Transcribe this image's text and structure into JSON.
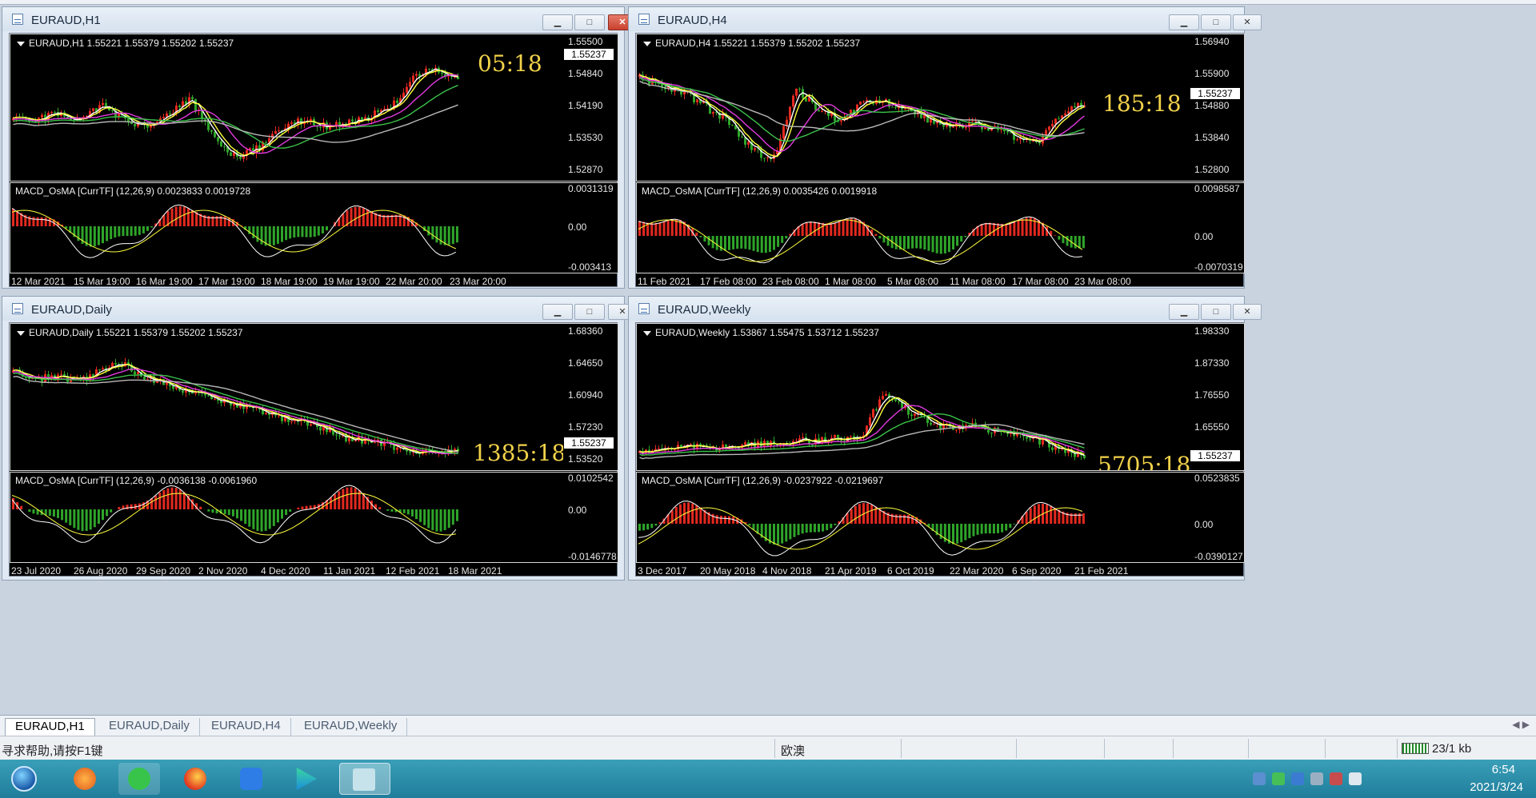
{
  "windows": [
    {
      "id": "h1",
      "title": "EURAUD,H1",
      "info": "EURAUD,H1  1.55221 1.55379 1.55202 1.55237",
      "timer": "05:18",
      "price_ticks": [
        "1.55500",
        "1.54840",
        "1.54190",
        "1.53530",
        "1.52870"
      ],
      "current_price": "1.55237",
      "osma_label": "MACD_OsMA [CurrTF] (12,26,9) 0.0023833 0.0019728",
      "osma_ticks": [
        "0.0031319",
        "0.00",
        "-0.003413"
      ],
      "time_labels": [
        "12 Mar 2021",
        "15 Mar 19:00",
        "16 Mar 19:00",
        "17 Mar 19:00",
        "18 Mar 19:00",
        "19 Mar 19:00",
        "22 Mar 20:00",
        "23 Mar 20:00"
      ],
      "active": true
    },
    {
      "id": "h4",
      "title": "EURAUD,H4",
      "info": "EURAUD,H4  1.55221 1.55379 1.55202 1.55237",
      "timer": "185:18",
      "price_ticks": [
        "1.56940",
        "1.55900",
        "1.54880",
        "1.53840",
        "1.52800"
      ],
      "current_price": "1.55237",
      "osma_label": "MACD_OsMA [CurrTF] (12,26,9) 0.0035426 0.0019918",
      "osma_ticks": [
        "0.0098587",
        "0.00",
        "-0.0070319"
      ],
      "time_labels": [
        "11 Feb 2021",
        "17 Feb 08:00",
        "23 Feb 08:00",
        "1 Mar 08:00",
        "5 Mar 08:00",
        "11 Mar 08:00",
        "17 Mar 08:00",
        "23 Mar 08:00"
      ],
      "active": false
    },
    {
      "id": "daily",
      "title": "EURAUD,Daily",
      "info": "EURAUD,Daily  1.55221 1.55379 1.55202 1.55237",
      "timer": "1385:18",
      "price_ticks": [
        "1.68360",
        "1.64650",
        "1.60940",
        "1.57230",
        "1.53520"
      ],
      "current_price": "1.55237",
      "osma_label": "MACD_OsMA [CurrTF] (12,26,9) -0.0036138 -0.0061960",
      "osma_ticks": [
        "0.0102542",
        "0.00",
        "-0.0146778"
      ],
      "time_labels": [
        "23 Jul 2020",
        "26 Aug 2020",
        "29 Sep 2020",
        "2 Nov 2020",
        "4 Dec 2020",
        "11 Jan 2021",
        "12 Feb 2021",
        "18 Mar 2021"
      ],
      "active": false
    },
    {
      "id": "weekly",
      "title": "EURAUD,Weekly",
      "info": "EURAUD,Weekly  1.53867 1.55475 1.53712 1.55237",
      "timer": "5705:18",
      "price_ticks": [
        "1.98330",
        "1.87330",
        "1.76550",
        "1.65550",
        "1.55237"
      ],
      "current_price": "1.55237",
      "osma_label": "MACD_OsMA [CurrTF] (12,26,9) -0.0237922 -0.0219697",
      "osma_ticks": [
        "0.0523835",
        "0.00",
        "-0.0390127"
      ],
      "time_labels": [
        "3 Dec 2017",
        "20 May 2018",
        "4 Nov 2018",
        "21 Apr 2019",
        "6 Oct 2019",
        "22 Mar 2020",
        "6 Sep 2020",
        "21 Feb 2021"
      ],
      "active": false
    }
  ],
  "tabs": [
    "EURAUD,H1",
    "EURAUD,Daily",
    "EURAUD,H4",
    "EURAUD,Weekly"
  ],
  "status": {
    "help": "寻求帮助,请按F1键",
    "symbol": "欧澳",
    "traffic": "23/1 kb"
  },
  "taskbar": {
    "time": "6:54",
    "date": "2021/3/24"
  },
  "colors": {
    "bull": "#e3291f",
    "bear": "#2fa52a",
    "ma_white": "#ffffff",
    "ma_yellow": "#ffff3c",
    "ma_magenta": "#e23ae0",
    "ma_green": "#3bc24a",
    "ma_gray": "#b9b9b9",
    "timer": "#f2d24a"
  }
}
